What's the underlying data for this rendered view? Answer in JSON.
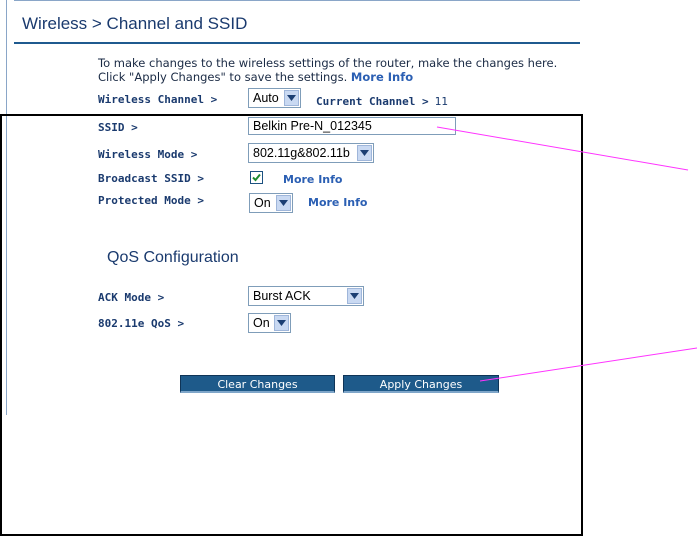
{
  "page": {
    "title": "Wireless > Channel and SSID",
    "intro_text": "To make changes to the wireless settings of the router, make the changes here. Click \"Apply Changes\" to save the settings.",
    "intro_link": "More Info"
  },
  "wireless_channel": {
    "label": "Wireless Channel >",
    "value": "Auto",
    "current_label": "Current Channel >",
    "current_value": "11"
  },
  "ssid": {
    "label": "SSID >",
    "value": "Belkin Pre-N_012345"
  },
  "wireless_mode": {
    "label": "Wireless Mode >",
    "value": "802.11g&802.11b"
  },
  "broadcast_ssid": {
    "label": "Broadcast SSID >",
    "checked": true,
    "more_info": "More Info"
  },
  "protected_mode": {
    "label": "Protected Mode >",
    "value": "On",
    "more_info": "More Info"
  },
  "qos": {
    "title": "QoS Configuration",
    "ack_mode": {
      "label": "ACK Mode >",
      "value": "Burst ACK"
    },
    "wmm": {
      "label": "802.11e QoS >",
      "value": "On"
    }
  },
  "buttons": {
    "clear": "Clear Changes",
    "apply": "Apply Changes"
  },
  "colors": {
    "heading": "#1a3a6e",
    "button": "#1e5a8a",
    "link": "#2b5fb3",
    "callout": "#ff33ff"
  },
  "icons": [
    "chevron-down-icon",
    "checkmark-icon"
  ]
}
